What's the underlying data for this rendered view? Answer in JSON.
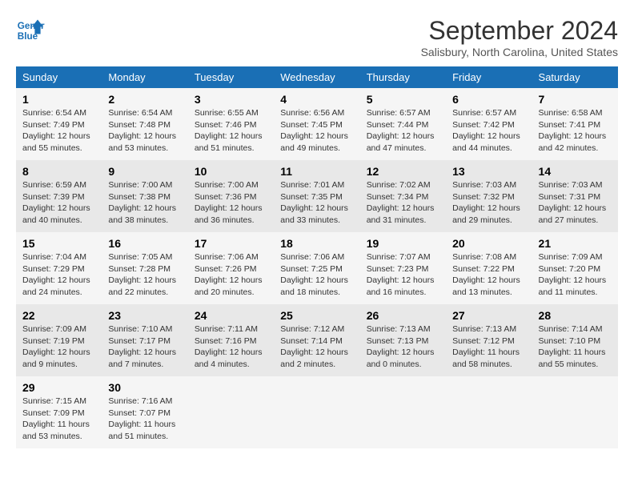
{
  "logo": {
    "line1": "General",
    "line2": "Blue"
  },
  "title": "September 2024",
  "location": "Salisbury, North Carolina, United States",
  "days_of_week": [
    "Sunday",
    "Monday",
    "Tuesday",
    "Wednesday",
    "Thursday",
    "Friday",
    "Saturday"
  ],
  "weeks": [
    [
      {
        "day": "1",
        "info": "Sunrise: 6:54 AM\nSunset: 7:49 PM\nDaylight: 12 hours\nand 55 minutes."
      },
      {
        "day": "2",
        "info": "Sunrise: 6:54 AM\nSunset: 7:48 PM\nDaylight: 12 hours\nand 53 minutes."
      },
      {
        "day": "3",
        "info": "Sunrise: 6:55 AM\nSunset: 7:46 PM\nDaylight: 12 hours\nand 51 minutes."
      },
      {
        "day": "4",
        "info": "Sunrise: 6:56 AM\nSunset: 7:45 PM\nDaylight: 12 hours\nand 49 minutes."
      },
      {
        "day": "5",
        "info": "Sunrise: 6:57 AM\nSunset: 7:44 PM\nDaylight: 12 hours\nand 47 minutes."
      },
      {
        "day": "6",
        "info": "Sunrise: 6:57 AM\nSunset: 7:42 PM\nDaylight: 12 hours\nand 44 minutes."
      },
      {
        "day": "7",
        "info": "Sunrise: 6:58 AM\nSunset: 7:41 PM\nDaylight: 12 hours\nand 42 minutes."
      }
    ],
    [
      {
        "day": "8",
        "info": "Sunrise: 6:59 AM\nSunset: 7:39 PM\nDaylight: 12 hours\nand 40 minutes."
      },
      {
        "day": "9",
        "info": "Sunrise: 7:00 AM\nSunset: 7:38 PM\nDaylight: 12 hours\nand 38 minutes."
      },
      {
        "day": "10",
        "info": "Sunrise: 7:00 AM\nSunset: 7:36 PM\nDaylight: 12 hours\nand 36 minutes."
      },
      {
        "day": "11",
        "info": "Sunrise: 7:01 AM\nSunset: 7:35 PM\nDaylight: 12 hours\nand 33 minutes."
      },
      {
        "day": "12",
        "info": "Sunrise: 7:02 AM\nSunset: 7:34 PM\nDaylight: 12 hours\nand 31 minutes."
      },
      {
        "day": "13",
        "info": "Sunrise: 7:03 AM\nSunset: 7:32 PM\nDaylight: 12 hours\nand 29 minutes."
      },
      {
        "day": "14",
        "info": "Sunrise: 7:03 AM\nSunset: 7:31 PM\nDaylight: 12 hours\nand 27 minutes."
      }
    ],
    [
      {
        "day": "15",
        "info": "Sunrise: 7:04 AM\nSunset: 7:29 PM\nDaylight: 12 hours\nand 24 minutes."
      },
      {
        "day": "16",
        "info": "Sunrise: 7:05 AM\nSunset: 7:28 PM\nDaylight: 12 hours\nand 22 minutes."
      },
      {
        "day": "17",
        "info": "Sunrise: 7:06 AM\nSunset: 7:26 PM\nDaylight: 12 hours\nand 20 minutes."
      },
      {
        "day": "18",
        "info": "Sunrise: 7:06 AM\nSunset: 7:25 PM\nDaylight: 12 hours\nand 18 minutes."
      },
      {
        "day": "19",
        "info": "Sunrise: 7:07 AM\nSunset: 7:23 PM\nDaylight: 12 hours\nand 16 minutes."
      },
      {
        "day": "20",
        "info": "Sunrise: 7:08 AM\nSunset: 7:22 PM\nDaylight: 12 hours\nand 13 minutes."
      },
      {
        "day": "21",
        "info": "Sunrise: 7:09 AM\nSunset: 7:20 PM\nDaylight: 12 hours\nand 11 minutes."
      }
    ],
    [
      {
        "day": "22",
        "info": "Sunrise: 7:09 AM\nSunset: 7:19 PM\nDaylight: 12 hours\nand 9 minutes."
      },
      {
        "day": "23",
        "info": "Sunrise: 7:10 AM\nSunset: 7:17 PM\nDaylight: 12 hours\nand 7 minutes."
      },
      {
        "day": "24",
        "info": "Sunrise: 7:11 AM\nSunset: 7:16 PM\nDaylight: 12 hours\nand 4 minutes."
      },
      {
        "day": "25",
        "info": "Sunrise: 7:12 AM\nSunset: 7:14 PM\nDaylight: 12 hours\nand 2 minutes."
      },
      {
        "day": "26",
        "info": "Sunrise: 7:13 AM\nSunset: 7:13 PM\nDaylight: 12 hours\nand 0 minutes."
      },
      {
        "day": "27",
        "info": "Sunrise: 7:13 AM\nSunset: 7:12 PM\nDaylight: 11 hours\nand 58 minutes."
      },
      {
        "day": "28",
        "info": "Sunrise: 7:14 AM\nSunset: 7:10 PM\nDaylight: 11 hours\nand 55 minutes."
      }
    ],
    [
      {
        "day": "29",
        "info": "Sunrise: 7:15 AM\nSunset: 7:09 PM\nDaylight: 11 hours\nand 53 minutes."
      },
      {
        "day": "30",
        "info": "Sunrise: 7:16 AM\nSunset: 7:07 PM\nDaylight: 11 hours\nand 51 minutes."
      },
      {
        "day": "",
        "info": ""
      },
      {
        "day": "",
        "info": ""
      },
      {
        "day": "",
        "info": ""
      },
      {
        "day": "",
        "info": ""
      },
      {
        "day": "",
        "info": ""
      }
    ]
  ]
}
